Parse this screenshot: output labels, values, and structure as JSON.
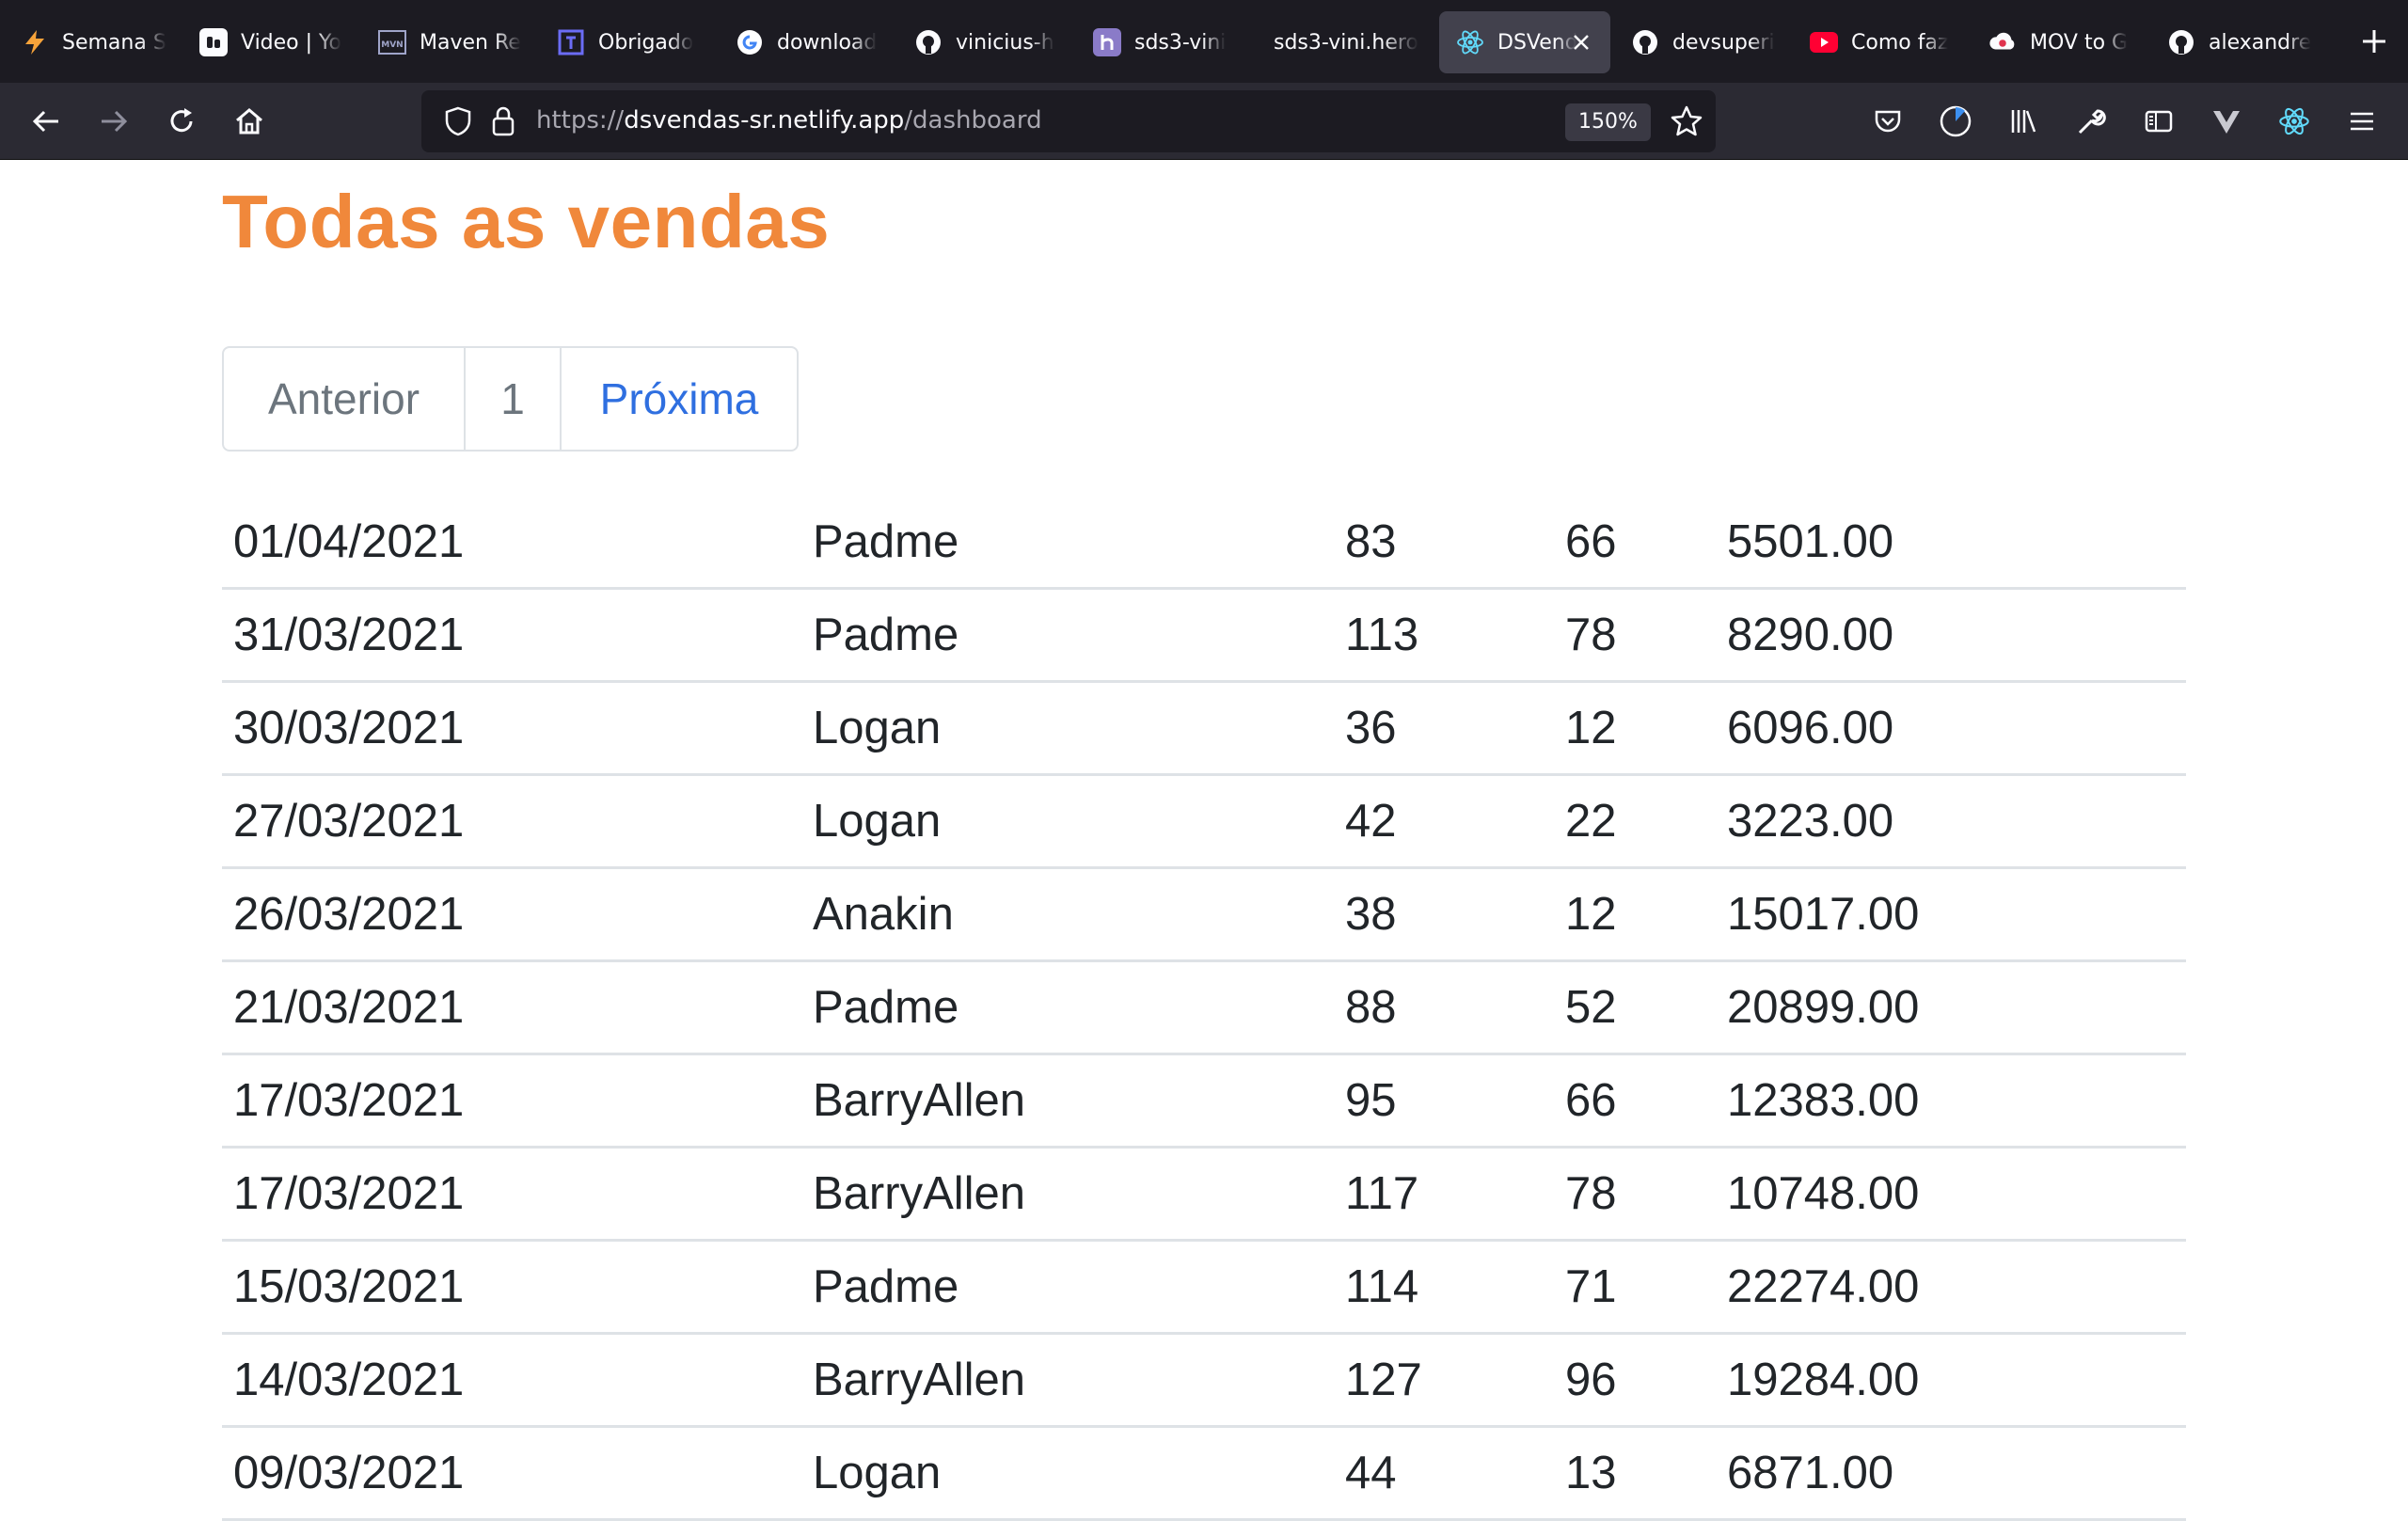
{
  "browser": {
    "tabs": [
      {
        "label": "Semana S",
        "icon": "lightning-icon",
        "active": false
      },
      {
        "label": "Video | Yo",
        "icon": "video-icon",
        "active": false
      },
      {
        "label": "Maven Re",
        "icon": "maven-icon",
        "active": false
      },
      {
        "label": "Obrigado",
        "icon": "bracket-icon",
        "active": false
      },
      {
        "label": "download",
        "icon": "google-icon",
        "active": false
      },
      {
        "label": "vinicius-h",
        "icon": "github-icon",
        "active": false
      },
      {
        "label": "sds3-vini",
        "icon": "heroku-icon",
        "active": false
      },
      {
        "label": "sds3-vini.hero",
        "icon": "",
        "active": false
      },
      {
        "label": "DSVend",
        "icon": "react-icon",
        "active": true
      },
      {
        "label": "devsuperi",
        "icon": "github-icon",
        "active": false
      },
      {
        "label": "Como faz",
        "icon": "youtube-icon",
        "active": false
      },
      {
        "label": "MOV to G",
        "icon": "cloud-icon",
        "active": false
      },
      {
        "label": "alexandre",
        "icon": "github-icon",
        "active": false
      }
    ],
    "url_prefix": "https://",
    "url_host": "dsvendas-sr.netlify.app",
    "url_path": "/dashboard",
    "zoom": "150%"
  },
  "page": {
    "title": "Todas as vendas"
  },
  "pagination": {
    "prev_label": "Anterior",
    "current_page": "1",
    "next_label": "Próxima"
  },
  "sales": [
    {
      "date": "01/04/2021",
      "seller": "Padme",
      "visited": "83",
      "deals": "66",
      "amount": "5501.00"
    },
    {
      "date": "31/03/2021",
      "seller": "Padme",
      "visited": "113",
      "deals": "78",
      "amount": "8290.00"
    },
    {
      "date": "30/03/2021",
      "seller": "Logan",
      "visited": "36",
      "deals": "12",
      "amount": "6096.00"
    },
    {
      "date": "27/03/2021",
      "seller": "Logan",
      "visited": "42",
      "deals": "22",
      "amount": "3223.00"
    },
    {
      "date": "26/03/2021",
      "seller": "Anakin",
      "visited": "38",
      "deals": "12",
      "amount": "15017.00"
    },
    {
      "date": "21/03/2021",
      "seller": "Padme",
      "visited": "88",
      "deals": "52",
      "amount": "20899.00"
    },
    {
      "date": "17/03/2021",
      "seller": "BarryAllen",
      "visited": "95",
      "deals": "66",
      "amount": "12383.00"
    },
    {
      "date": "17/03/2021",
      "seller": "BarryAllen",
      "visited": "117",
      "deals": "78",
      "amount": "10748.00"
    },
    {
      "date": "15/03/2021",
      "seller": "Padme",
      "visited": "114",
      "deals": "71",
      "amount": "22274.00"
    },
    {
      "date": "14/03/2021",
      "seller": "BarryAllen",
      "visited": "127",
      "deals": "96",
      "amount": "19284.00"
    },
    {
      "date": "09/03/2021",
      "seller": "Logan",
      "visited": "44",
      "deals": "13",
      "amount": "6871.00"
    }
  ],
  "colors": {
    "title": "#f0883b",
    "link": "#2f6fe0",
    "muted": "#6c757d",
    "row_border": "#dee2e6",
    "chrome_dark": "#1c1b22",
    "chrome_nav": "#2b2a33"
  }
}
